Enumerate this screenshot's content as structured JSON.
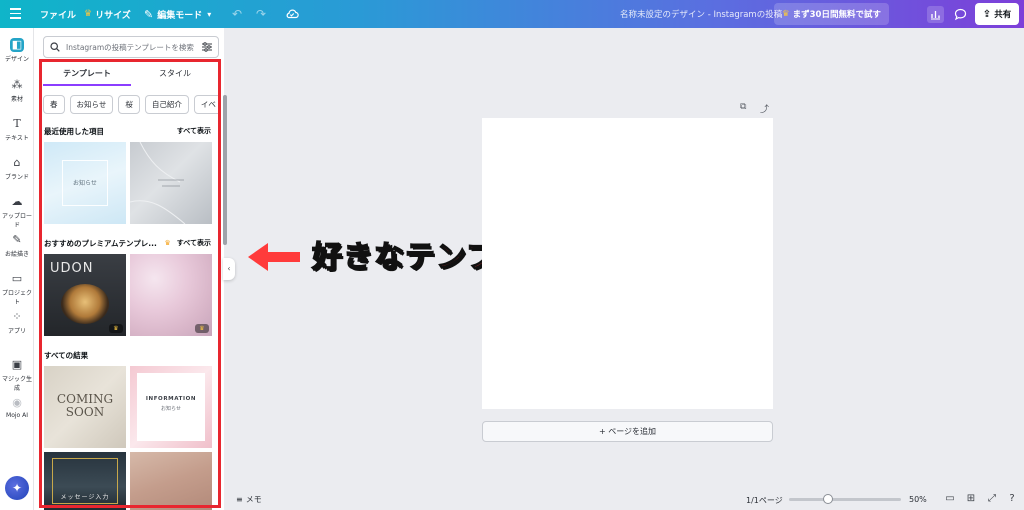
{
  "topbar": {
    "file": "ファイル",
    "resize": "リサイズ",
    "edit_mode": "編集モード",
    "doc_title": "名称未設定のデザイン - Instagramの投稿",
    "trial": "まず30日間無料で試す",
    "share": "共有"
  },
  "rail": {
    "items": [
      {
        "label": "デザイン"
      },
      {
        "label": "素材"
      },
      {
        "label": "テキスト"
      },
      {
        "label": "ブランド"
      },
      {
        "label": "アップロード"
      },
      {
        "label": "お絵描き"
      },
      {
        "label": "プロジェクト"
      },
      {
        "label": "アプリ"
      },
      {
        "label": "マジック生成"
      },
      {
        "label": "Mojo AI"
      }
    ]
  },
  "panel": {
    "search_placeholder": "Instagramの投稿テンプレートを検索",
    "tabs": [
      "テンプレート",
      "スタイル"
    ],
    "chips": [
      "春",
      "お知らせ",
      "桜",
      "自己紹介",
      "イベ"
    ],
    "recent": {
      "title": "最近使用した項目",
      "see_all": "すべて表示"
    },
    "premium": {
      "title": "おすすめのプレミアムテンプレ...",
      "see_all": "すべて表示"
    },
    "all_results": {
      "title": "すべての結果"
    },
    "thumbs": {
      "t1": "お知らせ",
      "t3": "UDON",
      "t5_1": "COMING",
      "t5_2": "SOON",
      "t6_1": "INFORMATION",
      "t6_2": "お知らせ",
      "t7": "メッセージ入力"
    }
  },
  "annotation": "好きなテンプレートを選択",
  "canvas": {
    "add_page": "+ ページを追加"
  },
  "bottom": {
    "memo": "メモ",
    "pages": "1/1ページ",
    "zoom": "50%",
    "zoom_level": 0.35
  }
}
